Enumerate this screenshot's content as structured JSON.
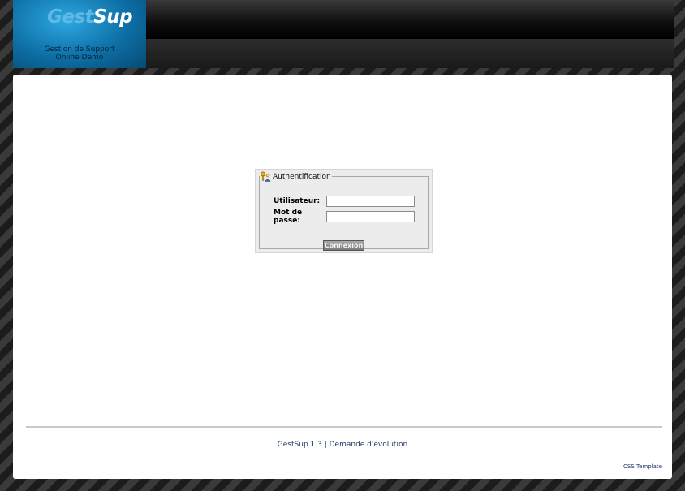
{
  "header": {
    "logo_part1": "Gest",
    "logo_part2": "Sup",
    "subtitle_line1": "Gestion de Support",
    "subtitle_line2": "Online Demo"
  },
  "auth": {
    "legend": "Authentification",
    "legend_icon": "keys-user-icon",
    "user_label": "Utilisateur:",
    "user_value": "",
    "password_label": "Mot de passe:",
    "password_value": "",
    "submit_label": "Connexion"
  },
  "footer": {
    "version": "GestSup 1.3",
    "separator": " | ",
    "feature_link": "Demande d'évolution",
    "css_template": "CSS Template"
  },
  "colors": {
    "logo_blue": "#0d6fa6",
    "link": "#1f3a66",
    "panel": "#ffffff"
  }
}
